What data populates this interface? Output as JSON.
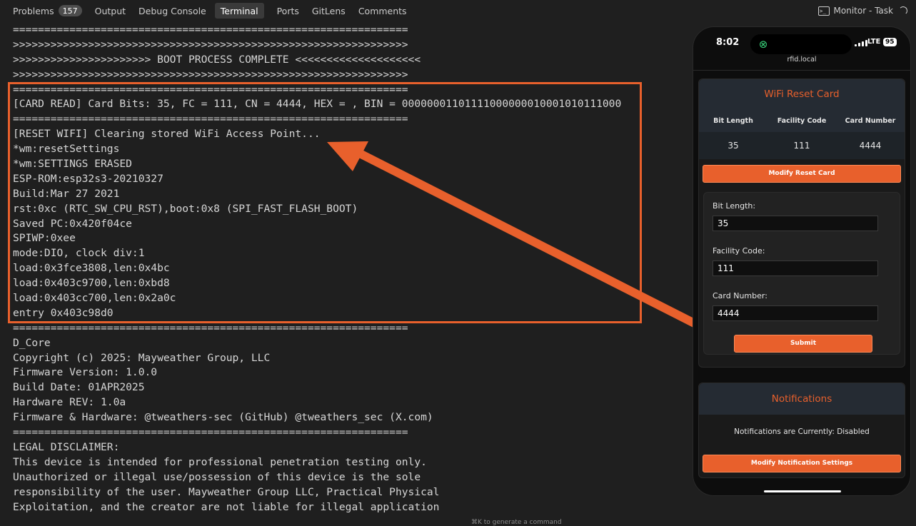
{
  "tabs": [
    {
      "label": "Problems",
      "badge": "157"
    },
    {
      "label": "Output"
    },
    {
      "label": "Debug Console"
    },
    {
      "label": "Terminal",
      "active": true
    },
    {
      "label": "Ports"
    },
    {
      "label": "GitLens"
    },
    {
      "label": "Comments"
    }
  ],
  "task": {
    "label": "Monitor - Task"
  },
  "terminal": {
    "lines": [
      "===============================================================",
      ">>>>>>>>>>>>>>>>>>>>>>>>>>>>>>>>>>>>>>>>>>>>>>>>>>>>>>>>>>>>>>>",
      ">>>>>>>>>>>>>>>>>>>>>> BOOT PROCESS COMPLETE <<<<<<<<<<<<<<<<<<<<",
      ">>>>>>>>>>>>>>>>>>>>>>>>>>>>>>>>>>>>>>>>>>>>>>>>>>>>>>>>>>>>>>>",
      "===============================================================",
      "[CARD READ] Card Bits: 35, FC = 111, CN = 4444, HEX = , BIN = 00000001101111000000010001010111000",
      "===============================================================",
      "[RESET WIFI] Clearing stored WiFi Access Point...",
      "*wm:resetSettings",
      "*wm:SETTINGS ERASED",
      "ESP-ROM:esp32s3-20210327",
      "Build:Mar 27 2021",
      "rst:0xc (RTC_SW_CPU_RST),boot:0x8 (SPI_FAST_FLASH_BOOT)",
      "Saved PC:0x420f04ce",
      "SPIWP:0xee",
      "mode:DIO, clock div:1",
      "load:0x3fce3808,len:0x4bc",
      "load:0x403c9700,len:0xbd8",
      "load:0x403cc700,len:0x2a0c",
      "entry 0x403c98d0",
      "===============================================================",
      "D_Core",
      "Copyright (c) 2025: Mayweather Group, LLC",
      "Firmware Version: 1.0.0",
      "Build Date: 01APR2025",
      "Hardware REV: 1.0a",
      "Firmware & Hardware: @tweathers-sec (GitHub) @tweathers_sec (X.com)",
      "===============================================================",
      "LEGAL DISCLAIMER:",
      "This device is intended for professional penetration testing only.",
      "Unauthorized or illegal use/possession of this device is the sole",
      "responsibility of the user. Mayweather Group LLC, Practical Physical",
      "Exploitation, and the creator are not liable for illegal application"
    ],
    "hint": "⌘K to generate a command"
  },
  "phone": {
    "time": "8:02",
    "network": "LTE",
    "battery": "95",
    "url": "rfid.local",
    "reset_card": {
      "title": "WiFi Reset Card",
      "headers": [
        "Bit Length",
        "Facility Code",
        "Card Number"
      ],
      "values": [
        "35",
        "111",
        "4444"
      ],
      "modify_label": "Modify Reset Card"
    },
    "form": {
      "bit_length_label": "Bit Length:",
      "bit_length_value": "35",
      "facility_code_label": "Facility Code:",
      "facility_code_value": "111",
      "card_number_label": "Card Number:",
      "card_number_value": "4444",
      "submit_label": "Submit"
    },
    "notifications": {
      "title": "Notifications",
      "status": "Notifications are Currently: Disabled",
      "modify_label": "Modify Notification Settings"
    }
  },
  "colors": {
    "accent": "#e8602c",
    "background": "#1f1f1f"
  }
}
